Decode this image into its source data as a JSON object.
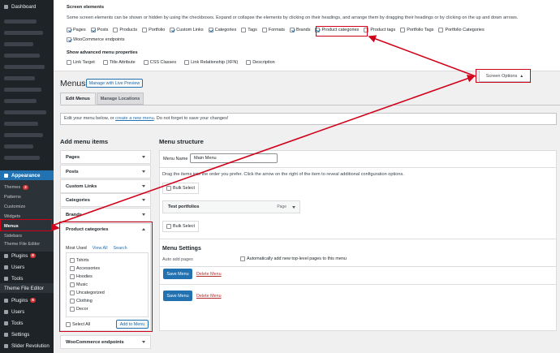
{
  "sidebar": {
    "dashboard": "Dashboard",
    "appearance": "Appearance",
    "submenu": [
      {
        "label": "Themes",
        "badge": "2"
      },
      {
        "label": "Patterns"
      },
      {
        "label": "Customize"
      },
      {
        "label": "Widgets"
      },
      {
        "label": "Menus"
      },
      {
        "label": "Sidebars"
      },
      {
        "label": "Theme File Editor"
      }
    ],
    "lower": [
      {
        "label": "Plugins",
        "badge": "9"
      },
      {
        "label": "Users"
      },
      {
        "label": "Tools"
      },
      {
        "label": "Theme File Editor"
      },
      {
        "label": "Plugins",
        "badge": "9"
      },
      {
        "label": "Users"
      },
      {
        "label": "Tools"
      },
      {
        "label": "Settings"
      },
      {
        "label": "Slider Revolution"
      }
    ]
  },
  "screen_options": {
    "title": "Screen elements",
    "description": "Some screen elements can be shown or hidden by using the checkboxes. Expand or collapse the elements by clicking on their headings, and arrange them by dragging their headings or by clicking on the up and down arrows.",
    "elements": [
      {
        "label": "Pages",
        "checked": true
      },
      {
        "label": "Posts",
        "checked": true
      },
      {
        "label": "Products",
        "checked": false
      },
      {
        "label": "Portfolio",
        "checked": false
      },
      {
        "label": "Custom Links",
        "checked": true
      },
      {
        "label": "Categories",
        "checked": true
      },
      {
        "label": "Tags",
        "checked": false
      },
      {
        "label": "Formats",
        "checked": false
      },
      {
        "label": "Brands",
        "checked": true
      },
      {
        "label": "Product categories",
        "checked": true
      },
      {
        "label": "Product tags",
        "checked": false
      },
      {
        "label": "Portfolio Tags",
        "checked": false
      },
      {
        "label": "Portfolio Categories",
        "checked": false
      }
    ],
    "woo_endpoints": {
      "label": "WooCommerce endpoints",
      "checked": true
    },
    "advanced_title": "Show advanced menu properties",
    "advanced": [
      {
        "label": "Link Target",
        "checked": false
      },
      {
        "label": "Title Attribute",
        "checked": false
      },
      {
        "label": "CSS Classes",
        "checked": false
      },
      {
        "label": "Link Relationship (XFN)",
        "checked": false
      },
      {
        "label": "Description",
        "checked": false
      }
    ],
    "tab_label": "Screen Options"
  },
  "page": {
    "title": "Menus",
    "live_preview": "Manage with Live Preview",
    "tabs": [
      "Edit Menus",
      "Manage Locations"
    ],
    "notice_before": "Edit your menu below, or ",
    "notice_link": "create a new menu",
    "notice_after": ". Do not forget to save your changes!"
  },
  "add_menu_items": {
    "heading": "Add menu items",
    "sections": [
      "Pages",
      "Posts",
      "Custom Links",
      "Categories",
      "Brands"
    ],
    "product_categories": {
      "title": "Product categories",
      "tabs": [
        "Most Used",
        "View All",
        "Search"
      ],
      "items": [
        "Tshirts",
        "Accessories",
        "Hoodies",
        "Music",
        "Uncategorized",
        "Clothing",
        "Decor"
      ],
      "select_all": "Select All",
      "add_button": "Add to Menu"
    },
    "woo_section": "WooCommerce endpoints"
  },
  "menu_structure": {
    "heading": "Menu structure",
    "name_label": "Menu Name",
    "name_value": "Main Menu",
    "instructions": "Drag the items into the order you prefer. Click the arrow on the right of the item to reveal additional configuration options.",
    "bulk_select": "Bulk Select",
    "item": {
      "title": "Test portfolios",
      "type": "Page"
    },
    "settings_heading": "Menu Settings",
    "auto_add_label": "Auto add pages",
    "auto_add_text": "Automatically add new top-level pages to this menu",
    "save": "Save Menu",
    "delete": "Delete Menu"
  },
  "colors": {
    "accent": "#2271b1",
    "annotation": "#d0021b",
    "sidebar": "#1d2327"
  }
}
